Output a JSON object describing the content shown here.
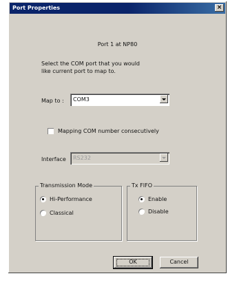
{
  "window": {
    "title": "Port Properties",
    "close_label": "×"
  },
  "header": {
    "port_caption": "Port 1 at NP80"
  },
  "instructions": {
    "line1": "Select the COM port that you would",
    "line2": "like current port to map to."
  },
  "map_to": {
    "label": "Map to :",
    "value": "COM3"
  },
  "mapping": {
    "label": "Mapping COM number consecutively",
    "checked": false
  },
  "interface": {
    "label": "Interface",
    "value": "RS232",
    "disabled": true
  },
  "transmission_mode": {
    "legend": "Transmission Mode",
    "options": [
      {
        "label": "Hi-Performance",
        "checked": true
      },
      {
        "label": "Classical",
        "checked": false
      }
    ]
  },
  "tx_fifo": {
    "legend": "Tx FIFO",
    "options": [
      {
        "label": "Enable",
        "checked": true
      },
      {
        "label": "Disable",
        "checked": false
      }
    ]
  },
  "buttons": {
    "ok": "OK",
    "cancel": "Cancel"
  }
}
